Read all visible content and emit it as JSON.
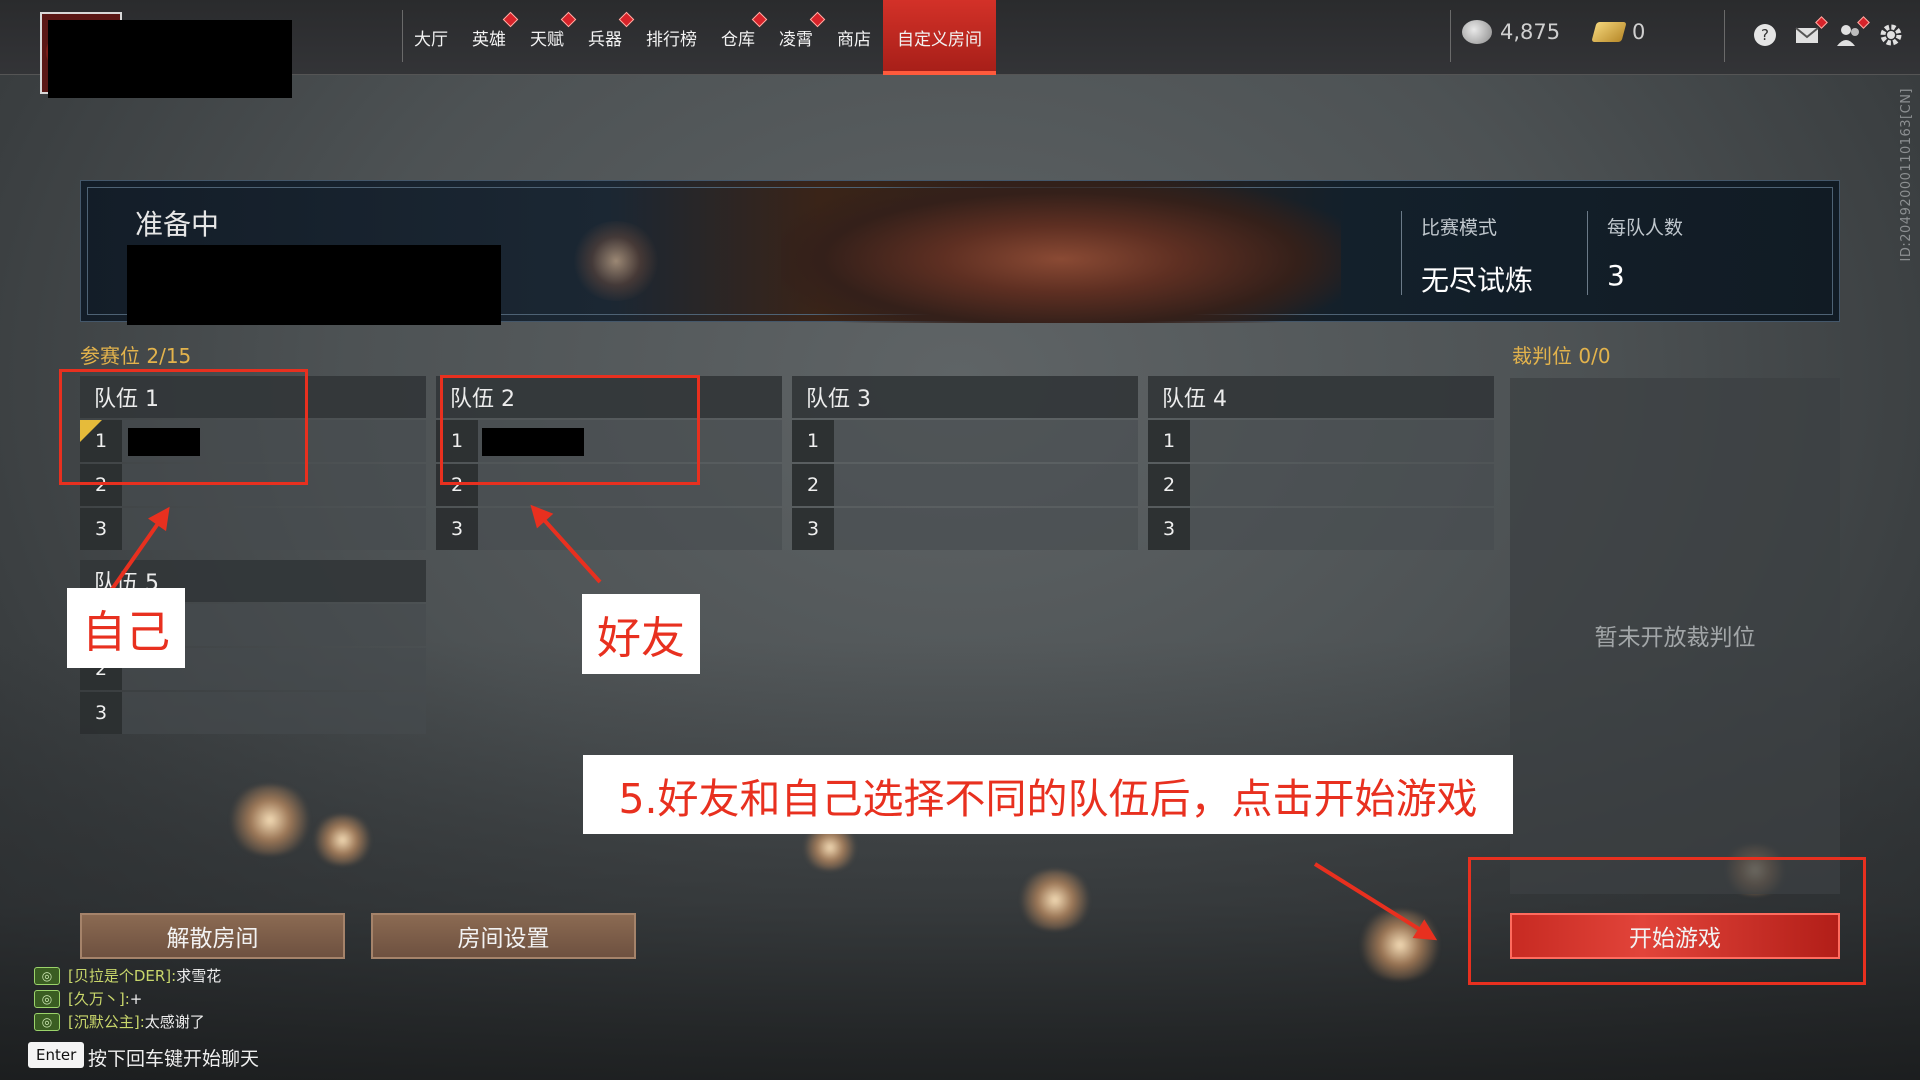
{
  "nav": {
    "items": [
      {
        "label": "大厅",
        "dot": false
      },
      {
        "label": "英雄",
        "dot": true
      },
      {
        "label": "天赋",
        "dot": true
      },
      {
        "label": "兵器",
        "dot": true
      },
      {
        "label": "排行榜",
        "dot": false
      },
      {
        "label": "仓库",
        "dot": true
      },
      {
        "label": "凌霄",
        "dot": true
      },
      {
        "label": "商店",
        "dot": false
      },
      {
        "label": "自定义房间",
        "dot": false,
        "active": true
      }
    ]
  },
  "currency": {
    "coins": "4,875",
    "gold": "0"
  },
  "id_text": "ID:2049200011016​3[CN]",
  "banner": {
    "status": "准备中",
    "mode_label": "比赛模式",
    "mode_value": "无尽试炼",
    "team_size_label": "每队人数",
    "team_size_value": "3"
  },
  "slots": {
    "label": "参赛位",
    "count": "2/15"
  },
  "referee": {
    "label": "裁判位",
    "count": "0/0",
    "empty_text": "暂未开放裁判位"
  },
  "teams": [
    {
      "name": "队伍 1",
      "rows": [
        "1",
        "2",
        "3"
      ]
    },
    {
      "name": "队伍 2",
      "rows": [
        "1",
        "2",
        "3"
      ]
    },
    {
      "name": "队伍 3",
      "rows": [
        "1",
        "2",
        "3"
      ]
    },
    {
      "name": "队伍 4",
      "rows": [
        "1",
        "2",
        "3"
      ]
    },
    {
      "name": "队伍 5",
      "rows": [
        "1",
        "2",
        "3"
      ]
    }
  ],
  "buttons": {
    "disband": "解散房间",
    "settings": "房间设置",
    "start": "开始游戏"
  },
  "chat": {
    "lines": [
      {
        "name": "[贝拉是个DER]:",
        "msg": "求雪花"
      },
      {
        "name": "[久万丶]:",
        "msg": "+"
      },
      {
        "name": "[沉默公主]:",
        "msg": "太感谢了"
      }
    ],
    "enter_key": "Enter",
    "hint": "按下回车键开始聊天"
  },
  "annotations": {
    "self": "自己",
    "friend": "好友",
    "instruction": "5.好友和自己选择不同的队伍后，点击开始游戏"
  },
  "colors": {
    "accent_red": "#d33128",
    "annotation_red": "#e8301f",
    "slot_gold": "#e3b34c"
  }
}
